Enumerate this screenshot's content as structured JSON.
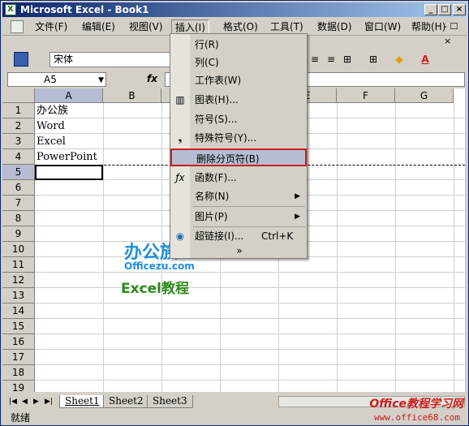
{
  "window": {
    "title": "Microsoft Excel - Book1"
  },
  "menubar": {
    "items": [
      "文件(F)",
      "编辑(E)",
      "视图(V)",
      "插入(I)",
      "格式(O)",
      "工具(T)",
      "数据(D)",
      "窗口(W)",
      "帮助(H)"
    ],
    "active_index": 3
  },
  "toolbar": {
    "font_name": "宋体"
  },
  "formula_bar": {
    "name_box": "A5",
    "fx_label": "fx",
    "content": ""
  },
  "grid": {
    "columns": [
      "A",
      "B",
      "C",
      "D",
      "E",
      "F",
      "G"
    ],
    "selected_column": "A",
    "rows": [
      "1",
      "2",
      "3",
      "4",
      "5",
      "6",
      "7",
      "8",
      "9",
      "10",
      "11",
      "12",
      "13",
      "14",
      "15",
      "16",
      "17",
      "18",
      "19"
    ],
    "selected_row": "5",
    "cells": {
      "A1": "办公族",
      "A2": "Word",
      "A3": "Excel",
      "A4": "PowerPoint"
    },
    "active_cell": "A5"
  },
  "insert_menu": {
    "items": [
      {
        "label": "行(R)",
        "icon": "",
        "submenu": false
      },
      {
        "label": "列(C)",
        "icon": "",
        "submenu": false
      },
      {
        "label": "工作表(W)",
        "icon": "",
        "submenu": false
      },
      {
        "label": "图表(H)...",
        "icon": "chart-icon",
        "submenu": false
      },
      {
        "label": "符号(S)...",
        "icon": "",
        "submenu": false
      },
      {
        "label": "特殊符号(Y)...",
        "icon": "special-symbol-icon",
        "submenu": false
      },
      {
        "label": "删除分页符(B)",
        "icon": "",
        "submenu": false,
        "highlighted": true
      },
      {
        "label": "函数(F)...",
        "icon": "fx-icon",
        "submenu": false
      },
      {
        "label": "名称(N)",
        "icon": "",
        "submenu": true
      },
      {
        "label": "图片(P)",
        "icon": "",
        "submenu": true
      },
      {
        "label": "超链接(I)...",
        "icon": "hyperlink-icon",
        "shortcut": "Ctrl+K",
        "submenu": false
      }
    ],
    "expand_label": "»"
  },
  "watermark": {
    "brand_cn": "办公族",
    "brand_url": "Officezu.com",
    "tutorial": "Excel教程"
  },
  "sheets": {
    "tabs": [
      "Sheet1",
      "Sheet2",
      "Sheet3"
    ],
    "active_index": 0
  },
  "status": {
    "text": "就绪"
  },
  "footer": {
    "site_name": "Office教程学习网",
    "site_url": "www.office68.com"
  },
  "colors": {
    "title_bar": "#0a246a",
    "highlight_border": "#cc1d1d",
    "selection": "#b6bdd2"
  }
}
